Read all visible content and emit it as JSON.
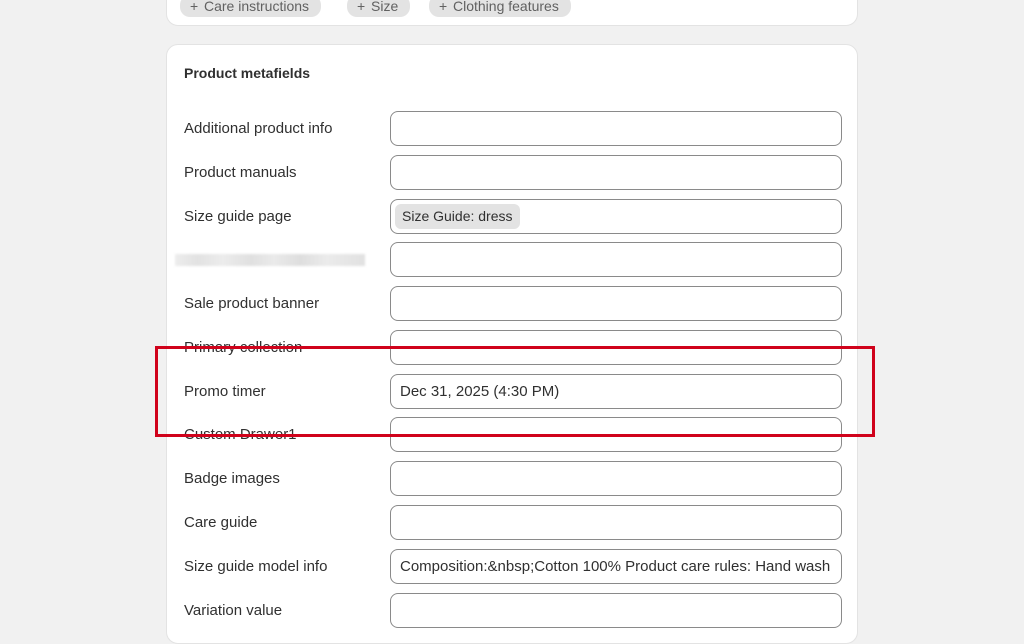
{
  "top_chips": [
    {
      "label": "Care instructions"
    },
    {
      "label": "Size"
    },
    {
      "label": "Clothing features"
    }
  ],
  "metafields": {
    "title": "Product metafields",
    "rows": [
      {
        "label": "Additional product info",
        "value": ""
      },
      {
        "label": "Product manuals",
        "value": ""
      },
      {
        "label": "Size guide page",
        "value": "Size Guide: dress"
      },
      {
        "label": "",
        "value": ""
      },
      {
        "label": "Sale product banner",
        "value": ""
      },
      {
        "label": "Primary collection",
        "value": ""
      },
      {
        "label": "Promo timer",
        "value": "Dec 31, 2025 (4:30 PM)"
      },
      {
        "label": "Custom Drawer1",
        "value": ""
      },
      {
        "label": "Badge images",
        "value": ""
      },
      {
        "label": "Care guide",
        "value": ""
      },
      {
        "label": "Size guide model info",
        "value": "Composition:&nbsp;Cotton 100% Product care rules: Hand wash"
      },
      {
        "label": "Variation value",
        "value": ""
      }
    ]
  },
  "colors": {
    "highlight": "#d0021b",
    "field_border": "#8a8a8a",
    "tag_background": "#e3e3e3",
    "page_background": "#f1f1f1"
  },
  "icons": {
    "chip_plus": "+"
  }
}
